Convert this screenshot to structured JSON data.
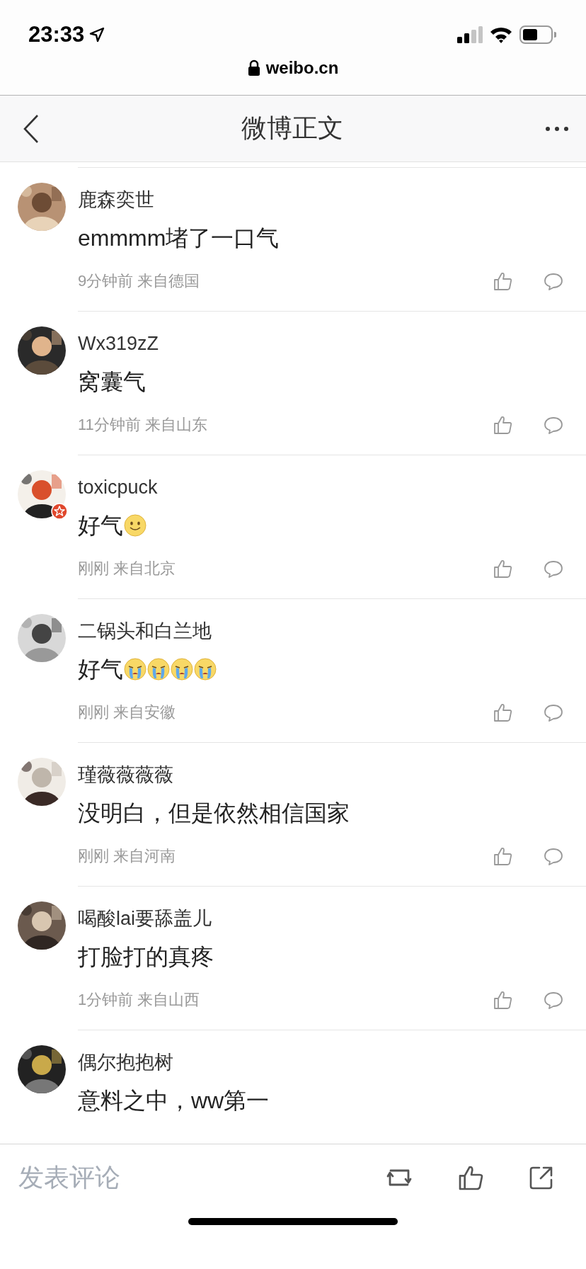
{
  "status_bar": {
    "time": "23:33"
  },
  "address_bar": {
    "url": "weibo.cn"
  },
  "nav_bar": {
    "title": "微博正文"
  },
  "comments": [
    {
      "user": "鹿森奕世",
      "verified": false,
      "text": "emmmm堵了一口气",
      "meta": "9分钟前 来自德国"
    },
    {
      "user": "Wx319zZ",
      "verified": false,
      "text": "窝囊气",
      "meta": "11分钟前 来自山东"
    },
    {
      "user": "toxicpuck",
      "verified": true,
      "text": "好气",
      "emojis": [
        {
          "kind": "smile"
        }
      ],
      "meta": "刚刚 来自北京"
    },
    {
      "user": "二锅头和白兰地",
      "verified": false,
      "text": "好气",
      "emojis": [
        {
          "kind": "cry"
        },
        {
          "kind": "cry"
        },
        {
          "kind": "cry"
        },
        {
          "kind": "cry"
        }
      ],
      "meta": "刚刚 来自安徽"
    },
    {
      "user": "瑾薇薇薇薇",
      "verified": false,
      "text": "没明白，但是依然相信国家",
      "meta": "刚刚 来自河南"
    },
    {
      "user": "喝酸lai要舔盖儿",
      "verified": false,
      "text": "打脸打的真疼",
      "meta": "1分钟前 来自山西"
    },
    {
      "user": "偶尔抱抱树",
      "verified": false,
      "text": "意料之中，ww第一"
    }
  ],
  "comment_box": {
    "placeholder": "发表评论"
  }
}
